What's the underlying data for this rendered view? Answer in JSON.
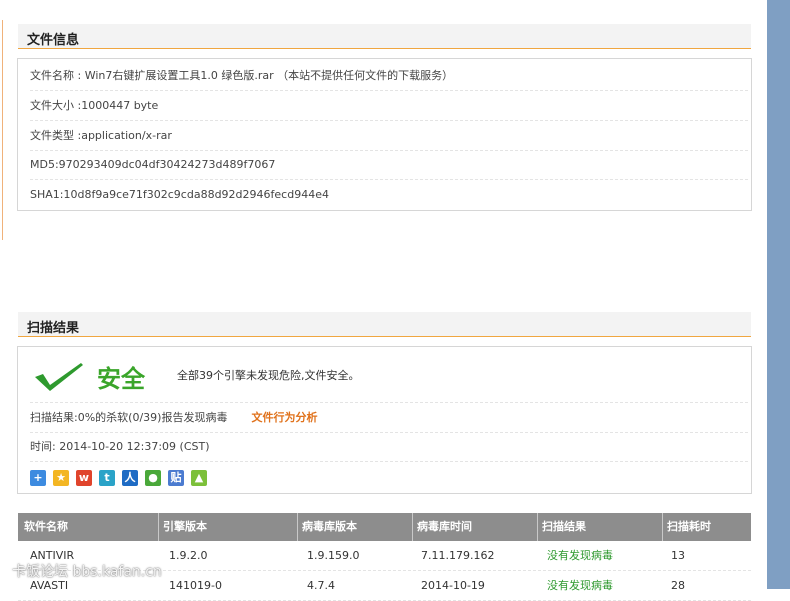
{
  "file_info": {
    "heading": "文件信息",
    "rows": [
      "文件名称 : Win7右键扩展设置工具1.0 绿色版.rar （本站不提供任何文件的下载服务）",
      "文件大小 :1000447 byte",
      "文件类型 :application/x-rar",
      "MD5:970293409dc04df30424273d489f7067",
      "SHA1:10d8f9a9ce71f302c9cda88d92d2946fecd944e4"
    ]
  },
  "scan": {
    "heading": "扫描结果",
    "status": "安全",
    "summary": "全部39个引擎未发现危险,文件安全。",
    "result_line": "扫描结果:0%的杀软(0/39)报告发现病毒",
    "behavior_link": "文件行为分析",
    "time_line": "时间: 2014-10-20 12:37:09 (CST)",
    "share_icons": [
      "plus-share-icon",
      "qzone-icon",
      "weibo-icon",
      "tencent-weibo-icon",
      "renren-icon",
      "wechat-icon",
      "tieba-icon",
      "kaixin-icon"
    ]
  },
  "table": {
    "headers": [
      "软件名称",
      "引擎版本",
      "病毒库版本",
      "病毒库时间",
      "扫描结果",
      "扫描耗时"
    ],
    "rows": [
      [
        "ANTIVIR",
        "1.9.2.0",
        "1.9.159.0",
        "7.11.179.162",
        "没有发现病毒",
        "13"
      ],
      [
        "AVASTI",
        "141019-0",
        "4.7.4",
        "2014-10-19",
        "没有发现病毒",
        "28"
      ]
    ]
  },
  "watermark": "卡饭论坛 bbs.kafan.cn",
  "colors": {
    "accent_orange": "#f0a640",
    "safe_green": "#3aa52a",
    "sidebar_blue": "#7f9fc3"
  }
}
